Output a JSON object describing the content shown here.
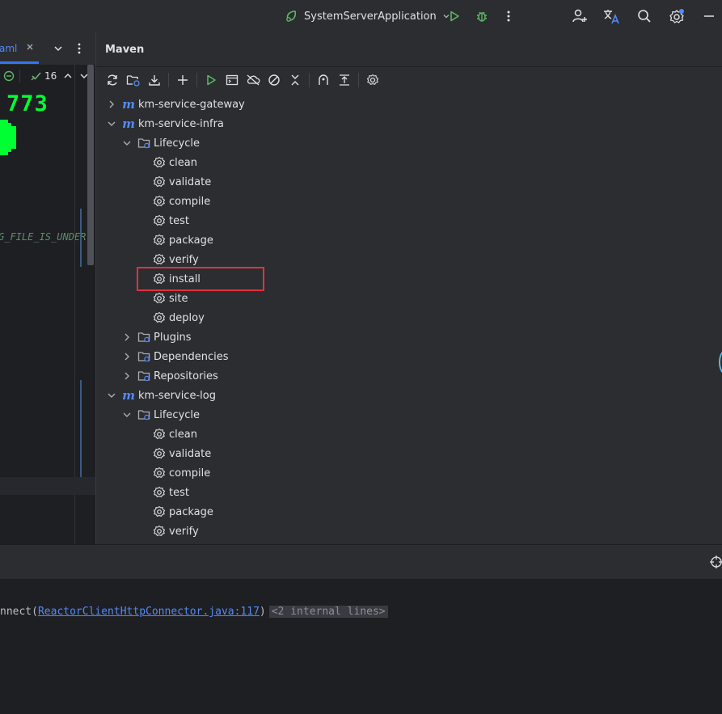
{
  "topbar": {
    "run_config": "SystemServerApplication",
    "icons": [
      "spring-boot-icon",
      "chevron-down-icon",
      "run-icon",
      "debug-icon",
      "more-vertical-icon",
      "add-user-icon",
      "translate-icon",
      "search-icon",
      "settings-icon",
      "minimize-icon"
    ]
  },
  "editor": {
    "tab_label": "aml",
    "inspection_count": "16",
    "ascii_text": "773",
    "code_fragment": "G_FILE_IS_UNDER"
  },
  "maven": {
    "title": "Maven",
    "tree": [
      {
        "label": "km-service-gateway",
        "type": "module",
        "expanded": false,
        "level": 0
      },
      {
        "label": "km-service-infra",
        "type": "module",
        "expanded": true,
        "level": 0
      },
      {
        "label": "Lifecycle",
        "type": "folder",
        "expanded": true,
        "level": 1
      },
      {
        "label": "clean",
        "type": "goal",
        "level": 2
      },
      {
        "label": "validate",
        "type": "goal",
        "level": 2
      },
      {
        "label": "compile",
        "type": "goal",
        "level": 2
      },
      {
        "label": "test",
        "type": "goal",
        "level": 2
      },
      {
        "label": "package",
        "type": "goal",
        "level": 2
      },
      {
        "label": "verify",
        "type": "goal",
        "level": 2
      },
      {
        "label": "install",
        "type": "goal",
        "level": 2
      },
      {
        "label": "site",
        "type": "goal",
        "level": 2
      },
      {
        "label": "deploy",
        "type": "goal",
        "level": 2
      },
      {
        "label": "Plugins",
        "type": "folder",
        "expanded": false,
        "level": 1
      },
      {
        "label": "Dependencies",
        "type": "folder",
        "expanded": false,
        "level": 1
      },
      {
        "label": "Repositories",
        "type": "folder",
        "expanded": false,
        "level": 1
      },
      {
        "label": "km-service-log",
        "type": "module",
        "expanded": true,
        "level": 0
      },
      {
        "label": "Lifecycle",
        "type": "folder",
        "expanded": true,
        "level": 1
      },
      {
        "label": "clean",
        "type": "goal",
        "level": 2
      },
      {
        "label": "validate",
        "type": "goal",
        "level": 2
      },
      {
        "label": "compile",
        "type": "goal",
        "level": 2
      },
      {
        "label": "test",
        "type": "goal",
        "level": 2
      },
      {
        "label": "package",
        "type": "goal",
        "level": 2
      },
      {
        "label": "verify",
        "type": "goal",
        "level": 2
      }
    ],
    "highlighted_item": "install"
  },
  "console": {
    "prefix": "nnect(",
    "link": "ReactorClientHttpConnector.java:117",
    "suffix": ")",
    "fold_label": "<2 internal lines>"
  },
  "colors": {
    "accent": "#548af7",
    "run_green": "#5fb865",
    "highlight_red": "#e0323d",
    "ascii_green": "#00ff33"
  }
}
